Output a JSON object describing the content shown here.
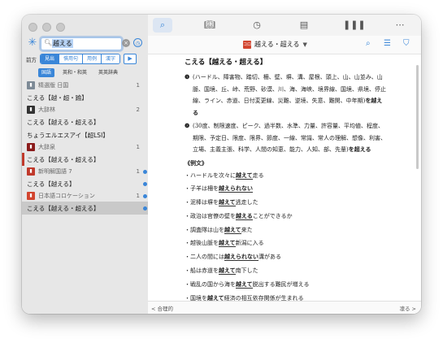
{
  "sidebar": {
    "search_value": "越える",
    "search_placeholder": "",
    "mode_label": "前方",
    "modes": [
      {
        "label": "見出"
      },
      {
        "label": "慣用句"
      },
      {
        "label": "用例"
      },
      {
        "label": "漢字"
      }
    ],
    "filters": [
      {
        "label": "国語"
      },
      {
        "label": "英和・和英"
      },
      {
        "label": "英英辞典"
      }
    ],
    "results": [
      {
        "type": "dict",
        "label": "精選版 日国",
        "count": "1",
        "icon_color": "#7d8a96"
      },
      {
        "type": "entry",
        "label": "こえる【越・超・踰】"
      },
      {
        "type": "dict",
        "label": "大辞林",
        "count": "2",
        "icon_color": "#333333"
      },
      {
        "type": "entry",
        "label": "こえる【越える・超える】"
      },
      {
        "type": "entry",
        "label": "ちょうエルエスアイ【超LSI】"
      },
      {
        "type": "dict",
        "label": "大辞泉",
        "count": "1",
        "icon_color": "#8b1c1c"
      },
      {
        "type": "entry",
        "label": "こえる【越える・超える】",
        "bar": true
      },
      {
        "type": "dict",
        "label": "新明解国語 7",
        "count": "1",
        "icon_color": "#c0392b",
        "dot": true
      },
      {
        "type": "entry",
        "label": "こえる【越える】",
        "dot": true
      },
      {
        "type": "dict",
        "label": "日本語コロケーション",
        "count": "1",
        "icon_color": "#d2452f",
        "dot": true
      },
      {
        "type": "entry",
        "label": "こえる【越える・超える】",
        "selected": true,
        "dot": true
      }
    ]
  },
  "toolbar": {
    "icons": [
      "search-icon",
      "book-icon",
      "clock-icon",
      "note-icon",
      "library-icon",
      "more-icon"
    ]
  },
  "subbar": {
    "title": "越える・超える",
    "dict_icon_text": "コロ"
  },
  "entry": {
    "headword": "こえる【越える・超える】",
    "sense1_num": "❶",
    "sense1_text": "(ハードル、障害物、踏切、柵、壁、塀、溝、屋根、頭上、山、山並み、山脈、国境、丘、峠、荒野、砂漠、川、海、海峡、境界線、国境、県境、停止線、ライン、赤道、日付変更線、災難、逆境、失意、難関、中年期)",
    "sense1_tail": "を越える",
    "sense2_num": "❷",
    "sense2_text": "(30度、制限速度、ピーク、過半数、水準、力量、許容量、平均値、程度、期限、予定日、限度、限界、節度、一線、常識、常人の理解、想像、利害、立場、主義主張、科学、人間の知恵、能力、人知、部、先輩)",
    "sense2_tail": "を超える",
    "examples_header": "《例文》",
    "examples": [
      {
        "pre": "・ハードルを次々に",
        "bold": "越えて",
        "post": "走る"
      },
      {
        "pre": "・子羊は柵を",
        "bold": "越えられない",
        "post": ""
      },
      {
        "pre": "・泥棒は塀を",
        "bold": "越えて",
        "post": "逃走した"
      },
      {
        "pre": "・政治は官僚の壁を",
        "bold": "越える",
        "post": "ことができるか"
      },
      {
        "pre": "・調査隊は山を",
        "bold": "越えて",
        "post": "来た"
      },
      {
        "pre": "・越後山脈を",
        "bold": "越えて",
        "post": "新潟に入る"
      },
      {
        "pre": "・二人の間には",
        "bold": "越えられない",
        "post": "溝がある"
      },
      {
        "pre": "・船は赤道を",
        "bold": "越えて",
        "post": "南下した"
      },
      {
        "pre": "・戦乱の国から海を",
        "bold": "越えて",
        "post": "脱出する難民が増える"
      },
      {
        "pre": "・国境を",
        "bold": "越えて",
        "post": "経済の相互依存関係が生まれる"
      }
    ]
  },
  "footer": {
    "prev_label": "< 合理的",
    "next_label": "凛る >"
  }
}
